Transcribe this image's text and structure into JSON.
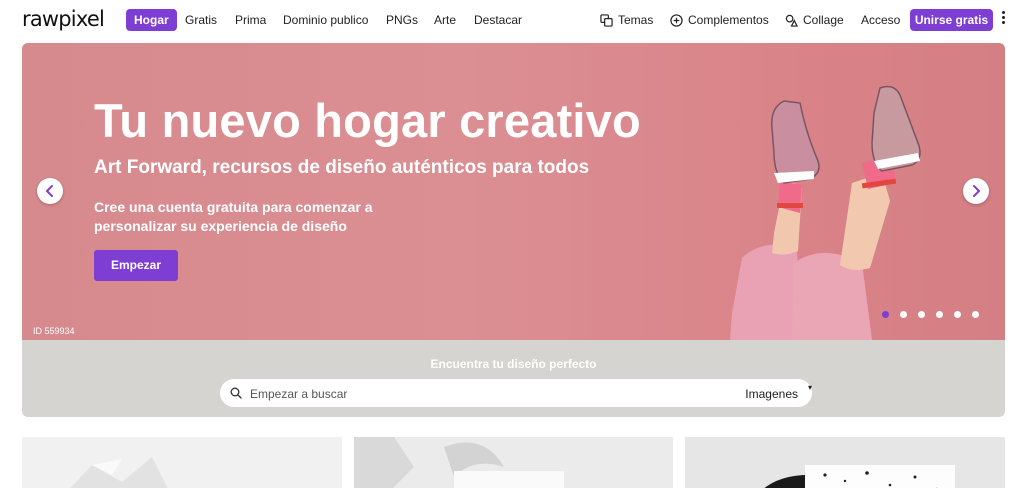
{
  "nav": {
    "logo": "rawpixel",
    "links": [
      "Hogar",
      "Gratis",
      "Prima",
      "Dominio publico",
      "PNGs",
      "Arte",
      "Destacar"
    ],
    "tools": [
      {
        "label": "Temas",
        "icon": "themes-icon"
      },
      {
        "label": "Complementos",
        "icon": "plus-circle-icon"
      },
      {
        "label": "Collage",
        "icon": "collage-icon"
      }
    ],
    "login": "Acceso",
    "join": "Unirse gratis"
  },
  "hero": {
    "title": "Tu nuevo hogar creativo",
    "subtitle": "Art Forward, recursos de diseño auténticos para todos",
    "text": "Cree una cuenta gratuita para comenzar a personalizar su experiencia de diseño",
    "cta": "Empezar",
    "image_id": "ID 559934",
    "slide_count": 6,
    "active_slide": 1
  },
  "search": {
    "title": "Encuentra tu diseño perfecto",
    "placeholder": "Empezar a buscar",
    "type": "Imagenes"
  },
  "colors": {
    "accent": "#7e3ed3",
    "hero_bg": "#d98d91",
    "search_band": "#d6d4d0"
  }
}
